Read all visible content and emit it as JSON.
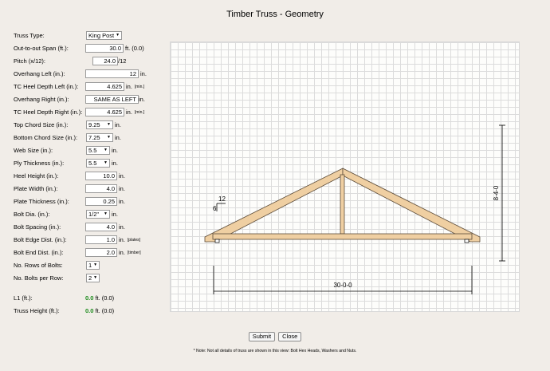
{
  "title": "Timber Truss - Geometry",
  "fields": {
    "truss_type": {
      "label": "Truss Type:",
      "value": "King Post"
    },
    "span": {
      "label": "Out-to-out Span (ft.):",
      "value": "30.0",
      "unit": "ft.",
      "extra": "(0.0)"
    },
    "pitch": {
      "label": "Pitch (x/12):",
      "value": "24.0",
      "unit": "/12"
    },
    "overhang_left": {
      "label": "Overhang Left (in.):",
      "value": "12",
      "unit": "in."
    },
    "tc_heel_left": {
      "label": "TC Heel Depth Left (in.):",
      "value": "4.625",
      "unit": "in.",
      "note": "[min.]"
    },
    "overhang_right": {
      "label": "Overhang Right (in.):",
      "value": "SAME AS LEFT",
      "unit": "in."
    },
    "tc_heel_right": {
      "label": "TC Heel Depth Right (in.):",
      "value": "4.625",
      "unit": "in.",
      "note": "[min.]"
    },
    "top_chord": {
      "label": "Top Chord Size (in.):",
      "value": "9.25",
      "unit": "in."
    },
    "bottom_chord": {
      "label": "Bottom Chord Size (in.):",
      "value": "7.25",
      "unit": "in."
    },
    "web_size": {
      "label": "Web Size (in.):",
      "value": "5.5",
      "unit": "in."
    },
    "ply_thickness": {
      "label": "Ply Thickness (in.):",
      "value": "5.5",
      "unit": "in."
    },
    "heel_height": {
      "label": "Heel Height (in.):",
      "value": "10.0",
      "unit": "in."
    },
    "plate_width": {
      "label": "Plate Width (in.):",
      "value": "4.0",
      "unit": "in."
    },
    "plate_thickness": {
      "label": "Plate Thickness (in.):",
      "value": "0.25",
      "unit": "in."
    },
    "bolt_dia": {
      "label": "Bolt Dia. (in.):",
      "value": "1/2\"",
      "unit": "in."
    },
    "bolt_spacing": {
      "label": "Bolt Spacing (in.):",
      "value": "4.0",
      "unit": "in."
    },
    "bolt_edge": {
      "label": "Bolt Edge Dist. (in.):",
      "value": "1.0",
      "unit": "in.",
      "note": "[plates]"
    },
    "bolt_end": {
      "label": "Bolt End Dist. (in.):",
      "value": "2.0",
      "unit": "in.",
      "note": "[timber]"
    },
    "rows_bolts": {
      "label": "No. Rows of Bolts:",
      "value": "1"
    },
    "bolts_per_row": {
      "label": "No. Bolts per Row:",
      "value": "2"
    }
  },
  "results": {
    "l1": {
      "label": "L1 (ft.):",
      "value": "0.0",
      "unit": "ft.",
      "extra": "(0.0)"
    },
    "truss_height": {
      "label": "Truss Height (ft.):",
      "value": "0.0",
      "unit": "ft.",
      "extra": "(0.0)"
    }
  },
  "drawing": {
    "pitch_rise": "6",
    "pitch_run": "12",
    "span_dim": "30-0-0",
    "height_dim": "8-4-0",
    "colors": {
      "timber": "#efcfa2",
      "outline": "#5a4a38",
      "dim": "#000000"
    }
  },
  "buttons": {
    "submit": "Submit",
    "close": "Close"
  },
  "note": "* Note: Not all details of truss are shown in this view: Bolt Hex Heads, Washers and Nuts."
}
